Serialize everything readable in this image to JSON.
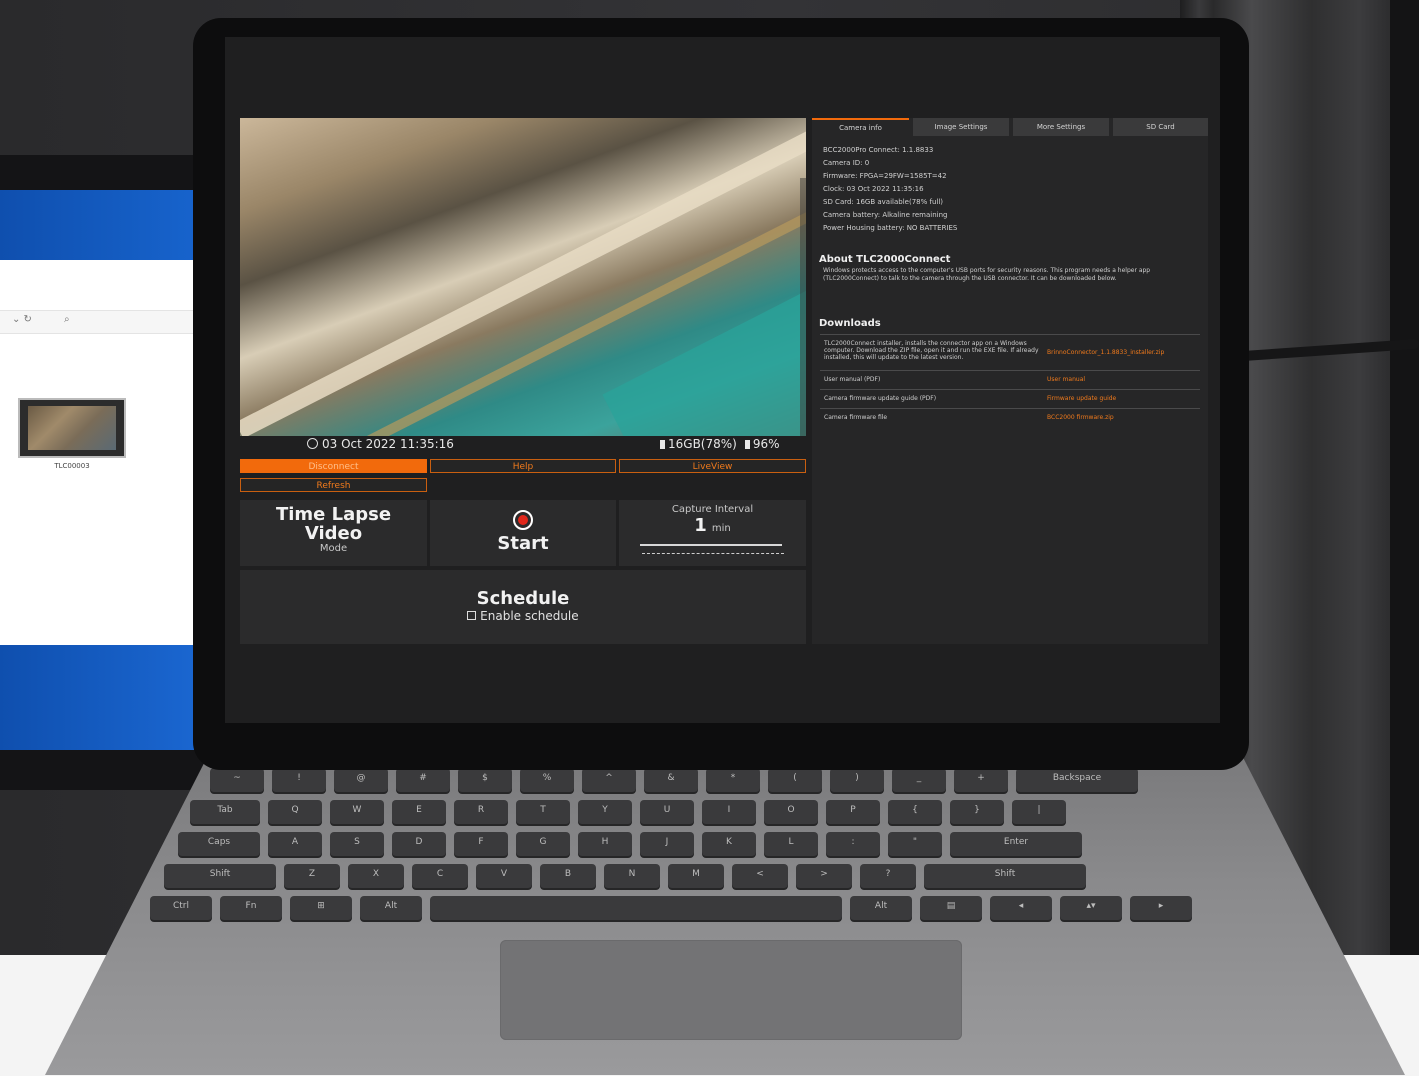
{
  "monitor": {
    "toolbar_glyphs": "⌄ ↻",
    "search_glyph": "⌕",
    "file_name": "TLC00003"
  },
  "app": {
    "status": {
      "datetime": "03 Oct 2022 11:35:16",
      "storage": "16GB(78%)",
      "battery": "96%"
    },
    "buttons": {
      "disconnect": "Disconnect",
      "help": "Help",
      "liveview": "LiveView",
      "refresh": "Refresh"
    },
    "mode_tile": {
      "line1": "Time Lapse",
      "line2": "Video",
      "caption": "Mode"
    },
    "start_tile": {
      "label": "Start"
    },
    "interval_tile": {
      "title": "Capture Interval",
      "value": "1",
      "unit": "min"
    },
    "schedule": {
      "title": "Schedule",
      "checkbox_label": "Enable schedule",
      "checked": false
    },
    "tabs": [
      "Camera info",
      "Image Settings",
      "More Settings",
      "SD Card"
    ],
    "active_tab": 0,
    "camera_info": [
      "BCC2000Pro Connect: 1.1.8833",
      "Camera ID: 0",
      "Firmware: FPGA=29FW=1585T=42",
      "Clock: 03 Oct 2022 11:35:16",
      "SD Card: 16GB available(78% full)",
      "Camera battery: Alkaline remaining",
      "Power Housing battery: NO BATTERIES"
    ],
    "about": {
      "title": "About TLC2000Connect",
      "text": "Windows protects access to the computer's USB ports for security reasons. This program needs a helper app (TLC2000Connect) to talk to the camera through the USB connector. It can be downloaded below."
    },
    "downloads": {
      "title": "Downloads",
      "rows": [
        {
          "label": "TLC2000Connect installer, installs the connector app on a Windows computer. Download the ZIP file, open it and run the EXE file. If already installed, this will update to the latest version.",
          "link": "BrinnoConnector_1.1.8833_installer.zip"
        },
        {
          "label": "User manual (PDF)",
          "link": "User manual"
        },
        {
          "label": "Camera firmware update guide (PDF)",
          "link": "Firmware update guide"
        },
        {
          "label": "Camera firmware file",
          "link": "BCC2000 firmware.zip"
        }
      ]
    }
  },
  "keyboard": {
    "row1": [
      "~",
      "!",
      "@",
      "#",
      "$",
      "%",
      "^",
      "&",
      "*",
      "(",
      ")",
      "_",
      "+",
      "Backspace"
    ],
    "row2": [
      "Tab",
      "Q",
      "W",
      "E",
      "R",
      "T",
      "Y",
      "U",
      "I",
      "O",
      "P",
      "{",
      "}",
      "|"
    ],
    "row3": [
      "Caps",
      "A",
      "S",
      "D",
      "F",
      "G",
      "H",
      "J",
      "K",
      "L",
      ":",
      "\"",
      "Enter"
    ],
    "row4": [
      "Shift",
      "Z",
      "X",
      "C",
      "V",
      "B",
      "N",
      "M",
      "<",
      ">",
      "?",
      "Shift"
    ],
    "row5": [
      "Ctrl",
      "Fn",
      "⊞",
      "Alt",
      "",
      "Alt",
      "▤",
      "◂",
      "▴▾",
      "▸"
    ]
  },
  "colors": {
    "accent": "#f26a0c",
    "record": "#e2261a",
    "panel": "#262627",
    "screen_bg": "#1f1f20"
  },
  "icons": {
    "clock": "clock-icon",
    "sd_card": "sd-card-icon",
    "battery": "battery-icon",
    "record": "record-icon",
    "checkbox": "checkbox-icon"
  }
}
